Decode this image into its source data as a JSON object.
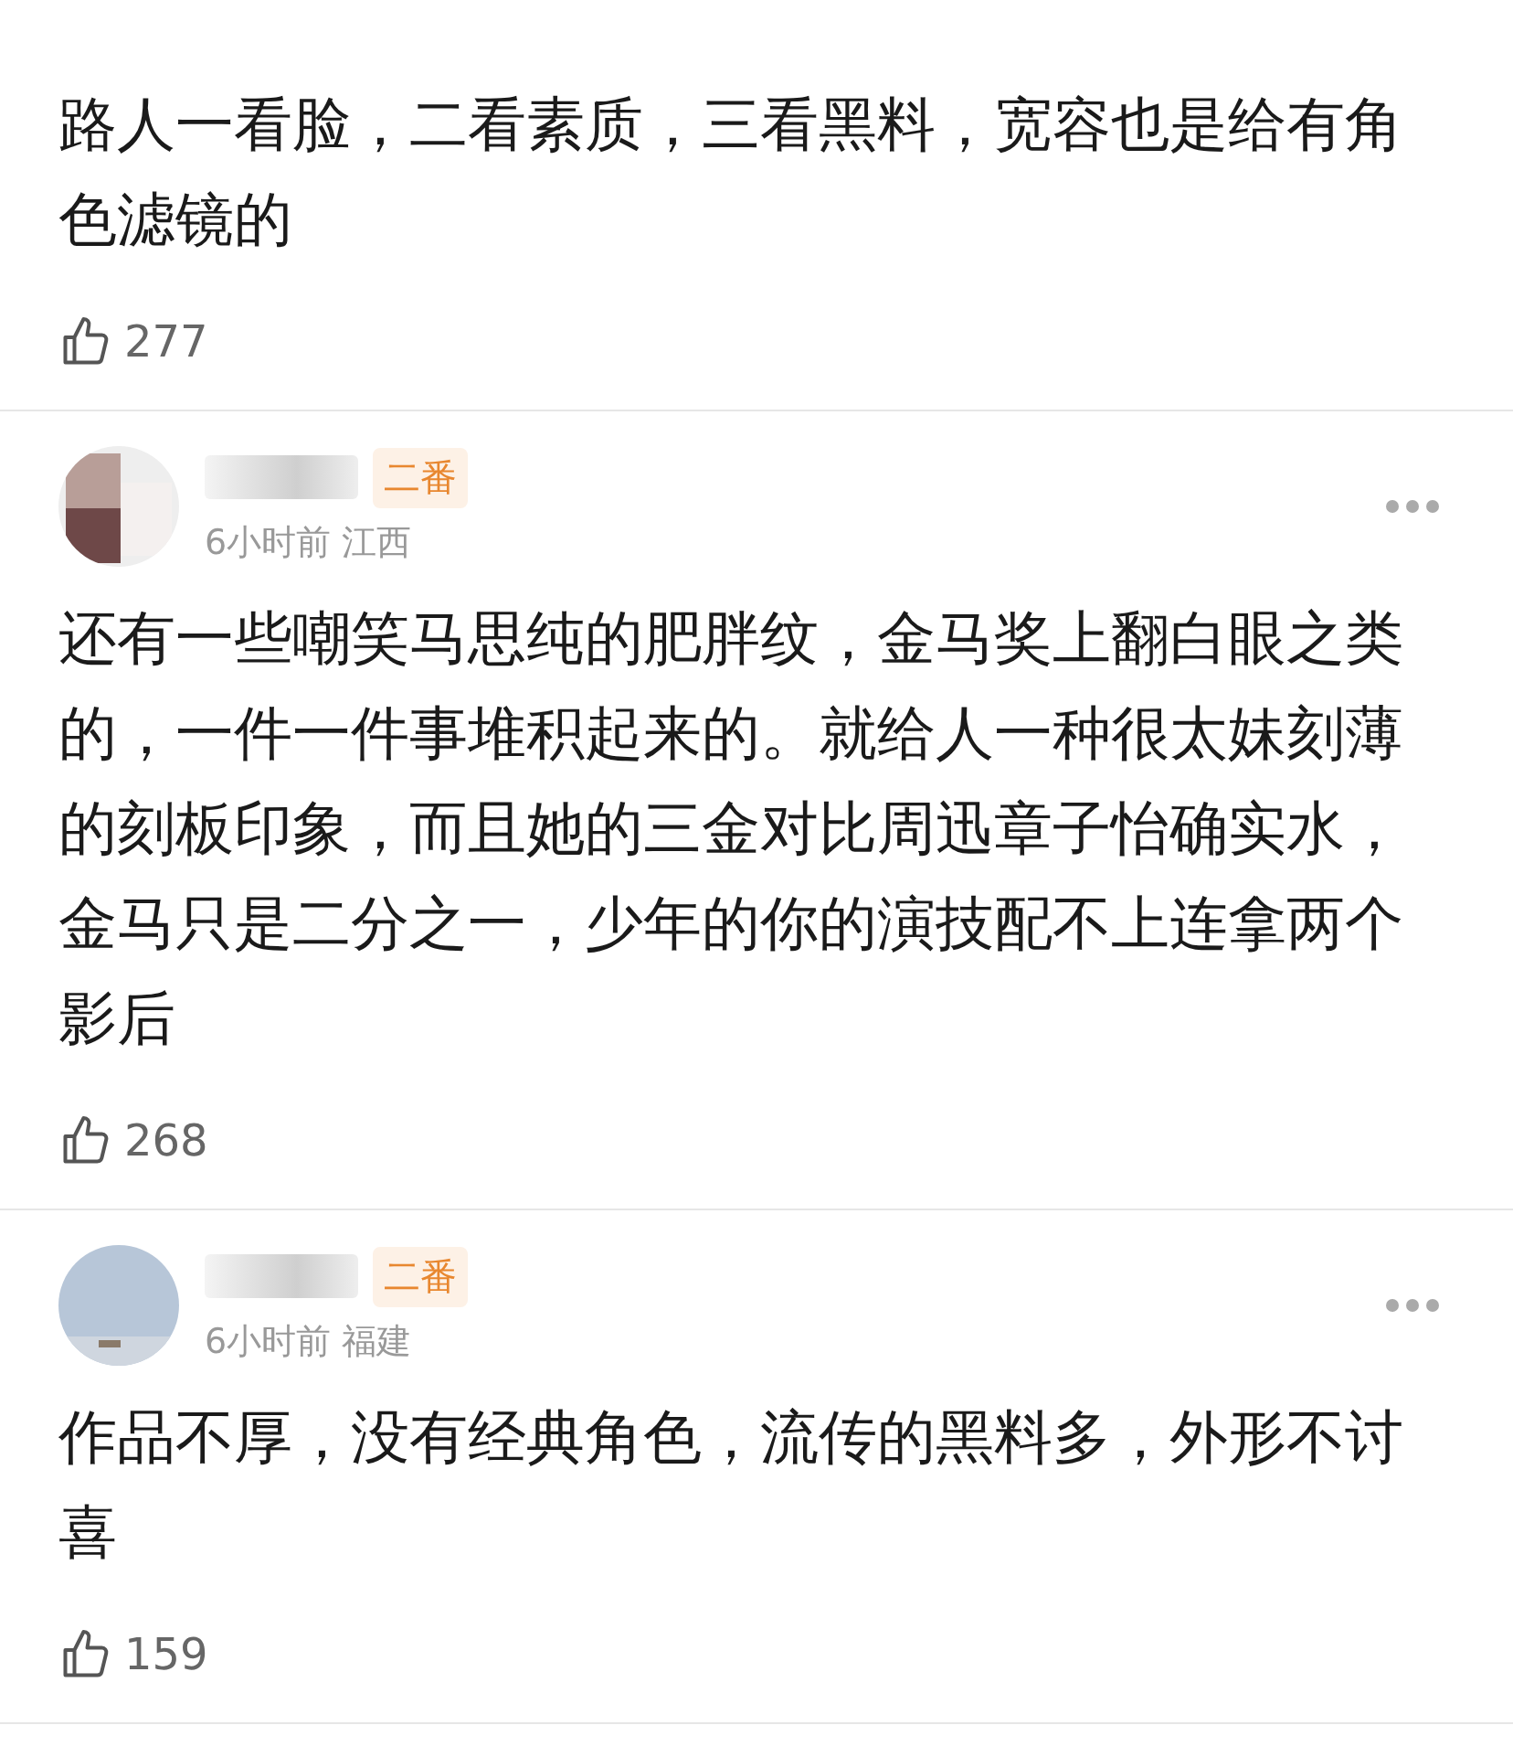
{
  "comments": [
    {
      "text": "路人一看脸，二看素质，三看黑料，宽容也是给有角色滤镜的",
      "likes": "277"
    },
    {
      "time": "6小时前",
      "location": "江西",
      "tag": "二番",
      "text": "还有一些嘲笑马思纯的肥胖纹，金马奖上翻白眼之类的，一件一件事堆积起来的。就给人一种很太妹刻薄的刻板印象，而且她的三金对比周迅章子怡确实水，金马只是二分之一，少年的你的演技配不上连拿两个影后",
      "likes": "268"
    },
    {
      "time": "6小时前",
      "location": "福建",
      "tag": "二番",
      "text": "作品不厚，没有经典角色，流传的黑料多，外形不讨喜",
      "likes": "159"
    }
  ]
}
